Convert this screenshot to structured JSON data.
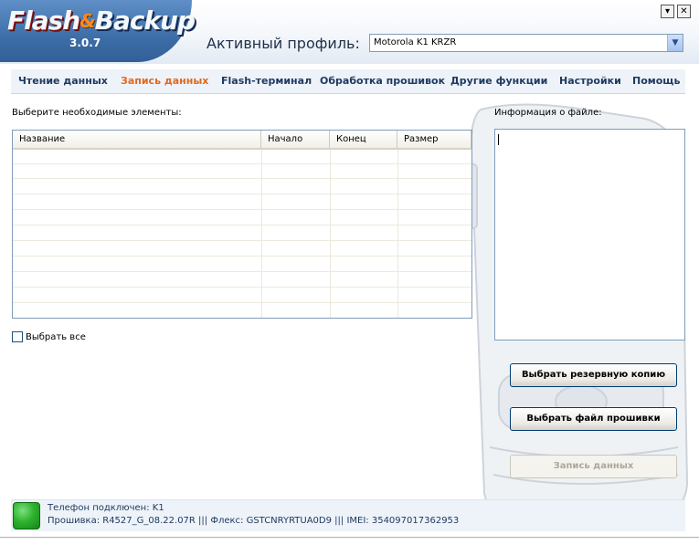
{
  "app": {
    "logo_word1": "Flash",
    "logo_amp": "&",
    "logo_word2": "Backup",
    "version": "3.0.7",
    "minimize_glyph": "▾",
    "close_glyph": "✕"
  },
  "profile": {
    "label": "Активный профиль:",
    "selected": "Motorola K1 KRZR",
    "arrow_glyph": "▼"
  },
  "nav": {
    "items": [
      {
        "label": "Чтение данных",
        "active": false
      },
      {
        "label": "Запись данных",
        "active": true
      },
      {
        "label": "Flash-терминал",
        "active": false
      },
      {
        "label": "Обработка прошивок",
        "active": false
      },
      {
        "label": "Другие функции",
        "active": false
      },
      {
        "label": "Настройки",
        "active": false
      },
      {
        "label": "Помощь",
        "active": false
      }
    ]
  },
  "main": {
    "select_label": "Выберите необходимые элементы:",
    "columns": [
      "Название",
      "Начало",
      "Конец",
      "Размер"
    ],
    "rows": [],
    "select_all_label": "Выбрать все",
    "select_all_checked": false
  },
  "file_info": {
    "label": "Информация о файле:",
    "text": ""
  },
  "actions": {
    "choose_backup": "Выбрать резервную копию",
    "choose_firmware": "Выбрать файл прошивки",
    "write_data": "Запись данных"
  },
  "status": {
    "line1": "Телефон подключен: K1",
    "line2": "Прошивка: R4527_G_08.22.07R ||| Флекс: GSTCNRYRTUA0D9 ||| IMEI: 354097017362953",
    "connection_color": "#2fb42f"
  },
  "icons": {
    "status_led": "status-led-icon",
    "phone_watermark": "phone-watermark-icon"
  }
}
